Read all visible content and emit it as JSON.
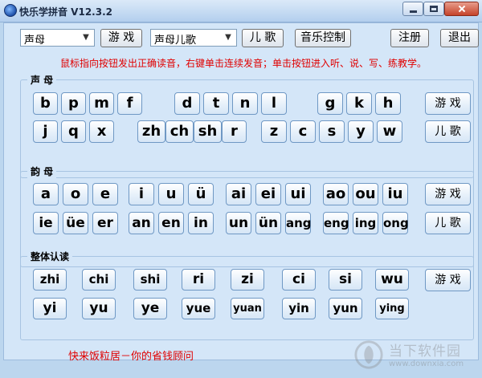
{
  "window": {
    "title": "快乐学拼音 V12.3.2",
    "icon": "app-logo-icon"
  },
  "toolbar": {
    "mode_select": "声母",
    "game_label": "游 戏",
    "song_select": "声母儿歌",
    "rhyme_label": "儿 歌",
    "music_label": "音乐控制",
    "register_label": "注册",
    "exit_label": "退出"
  },
  "hint_text": "鼠标指向按钮发出正确读音，右键单击连续发音；单击按钮进入听、说、写、练教学。",
  "groups": {
    "initials": {
      "title": "声    母",
      "row1": [
        "b",
        "p",
        "m",
        "f",
        "d",
        "t",
        "n",
        "l",
        "g",
        "k",
        "h"
      ],
      "row2": [
        "j",
        "q",
        "x",
        "zh",
        "ch",
        "sh",
        "r",
        "z",
        "c",
        "s",
        "y",
        "w"
      ],
      "game_label": "游 戏",
      "rhyme_label": "儿 歌"
    },
    "finals": {
      "title": "韵    母",
      "row1": [
        "a",
        "o",
        "e",
        "i",
        "u",
        "ü",
        "ai",
        "ei",
        "ui",
        "ao",
        "ou",
        "iu"
      ],
      "row2": [
        "ie",
        "üe",
        "er",
        "an",
        "en",
        "in",
        "un",
        "ün",
        "ang",
        "eng",
        "ing",
        "ong"
      ],
      "game_label": "游 戏",
      "rhyme_label": "儿 歌"
    },
    "whole": {
      "title": "整体认读",
      "row1": [
        "zhi",
        "chi",
        "shi",
        "ri",
        "zi",
        "ci",
        "si",
        "wu"
      ],
      "row2": [
        "yi",
        "yu",
        "ye",
        "yue",
        "yuan",
        "yin",
        "yun",
        "ying"
      ],
      "game_label": "游 戏"
    }
  },
  "footer_text": "快来饭粒居－你的省钱顾问",
  "watermark": {
    "text": "当下软件园",
    "url": "www.downxia.com"
  },
  "colors": {
    "accent_text": "#e00000",
    "background": "#d4e6f8",
    "key_border": "#6f98c4"
  }
}
